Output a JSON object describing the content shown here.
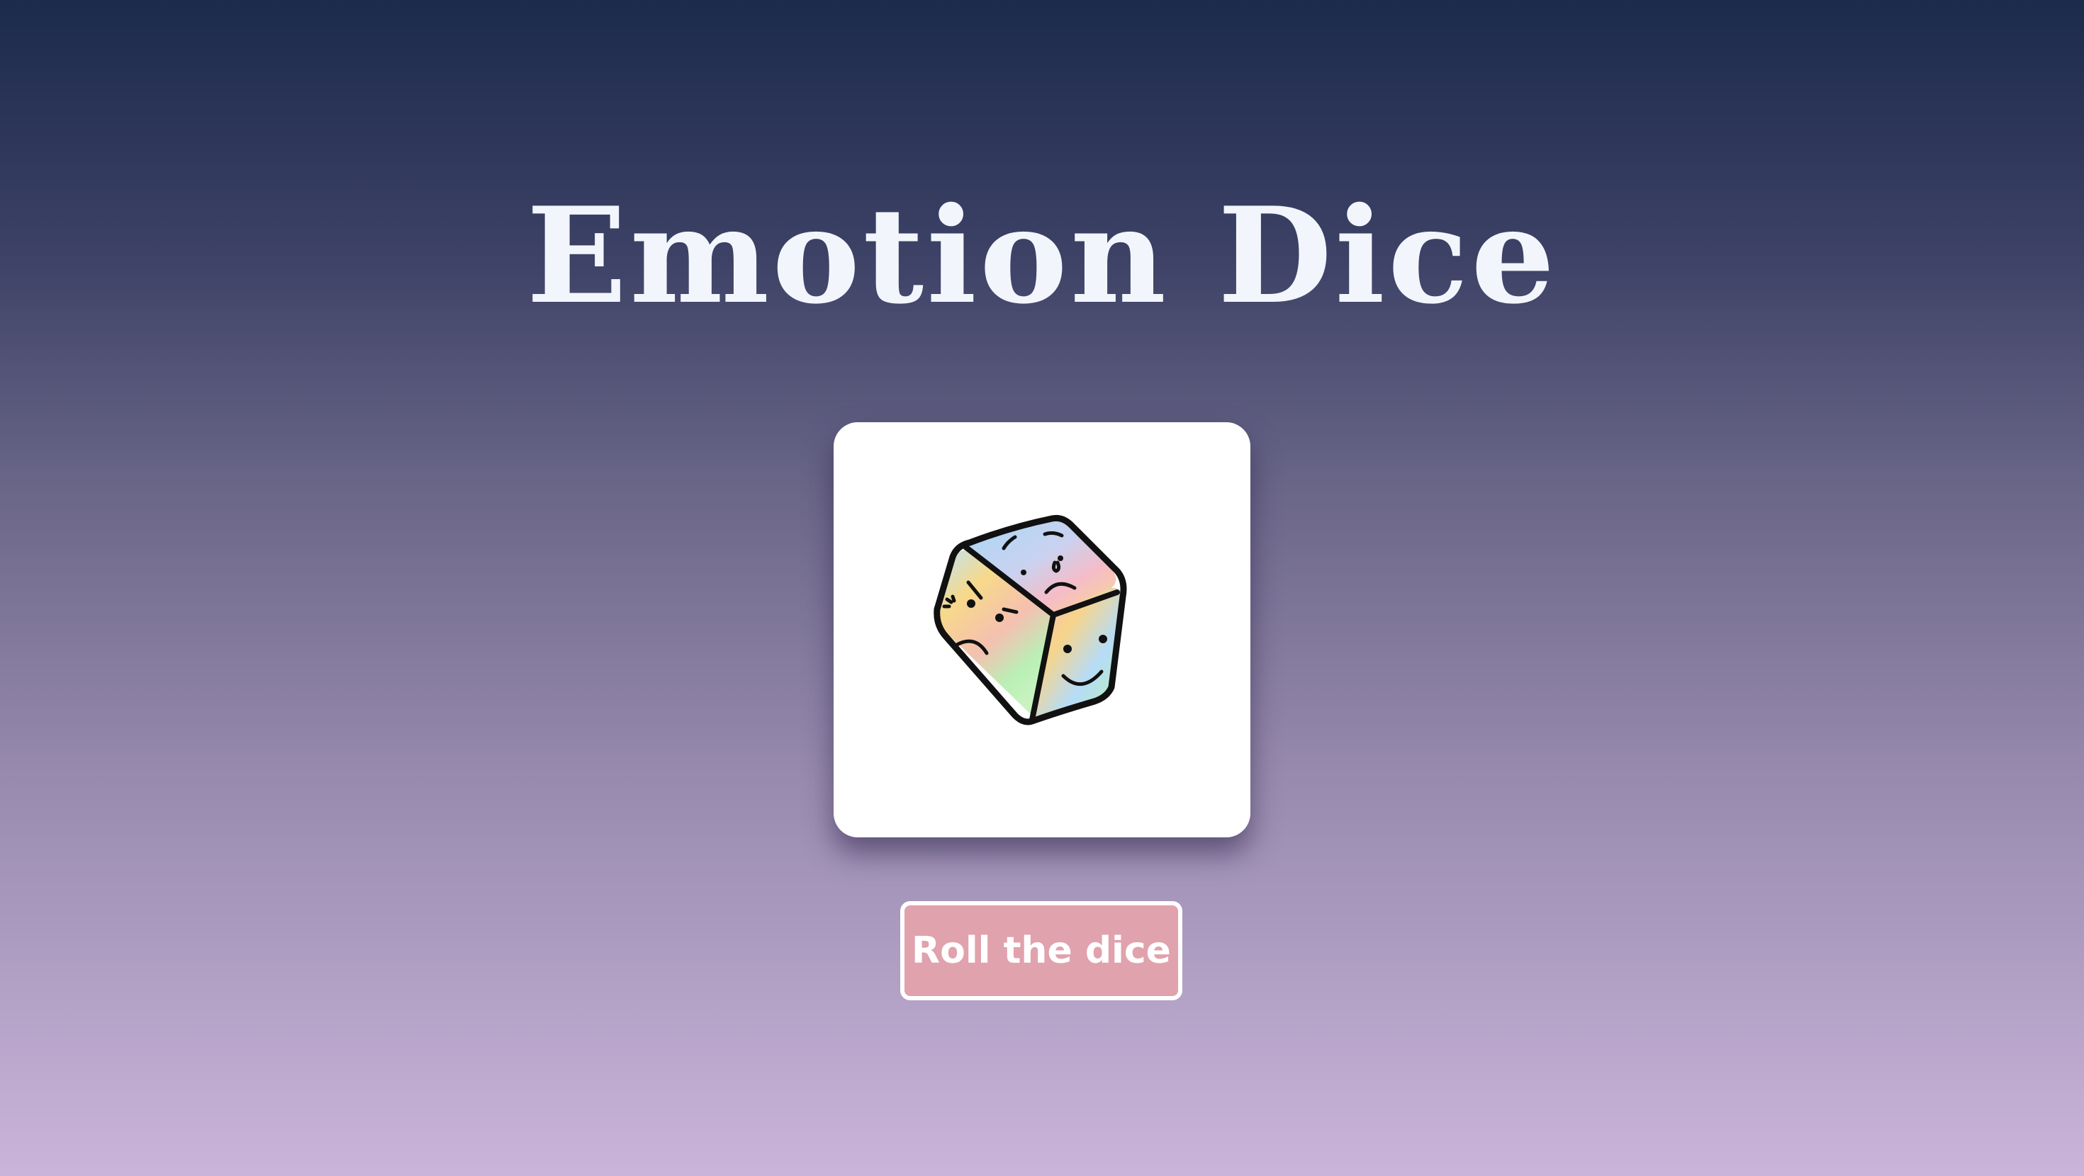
{
  "app": {
    "title": "Emotion Dice"
  },
  "dice": {
    "icon": "emotion-dice-icon",
    "faces": [
      "sad-crying-face",
      "angry-face",
      "happy-face"
    ]
  },
  "controls": {
    "roll_label": "Roll the dice"
  },
  "colors": {
    "background_top": "#1c2a4c",
    "background_bottom": "#cbb4da",
    "title": "#f2f6fc",
    "card": "#ffffff",
    "button": "#e0a2ad",
    "button_border": "#ffffff"
  }
}
